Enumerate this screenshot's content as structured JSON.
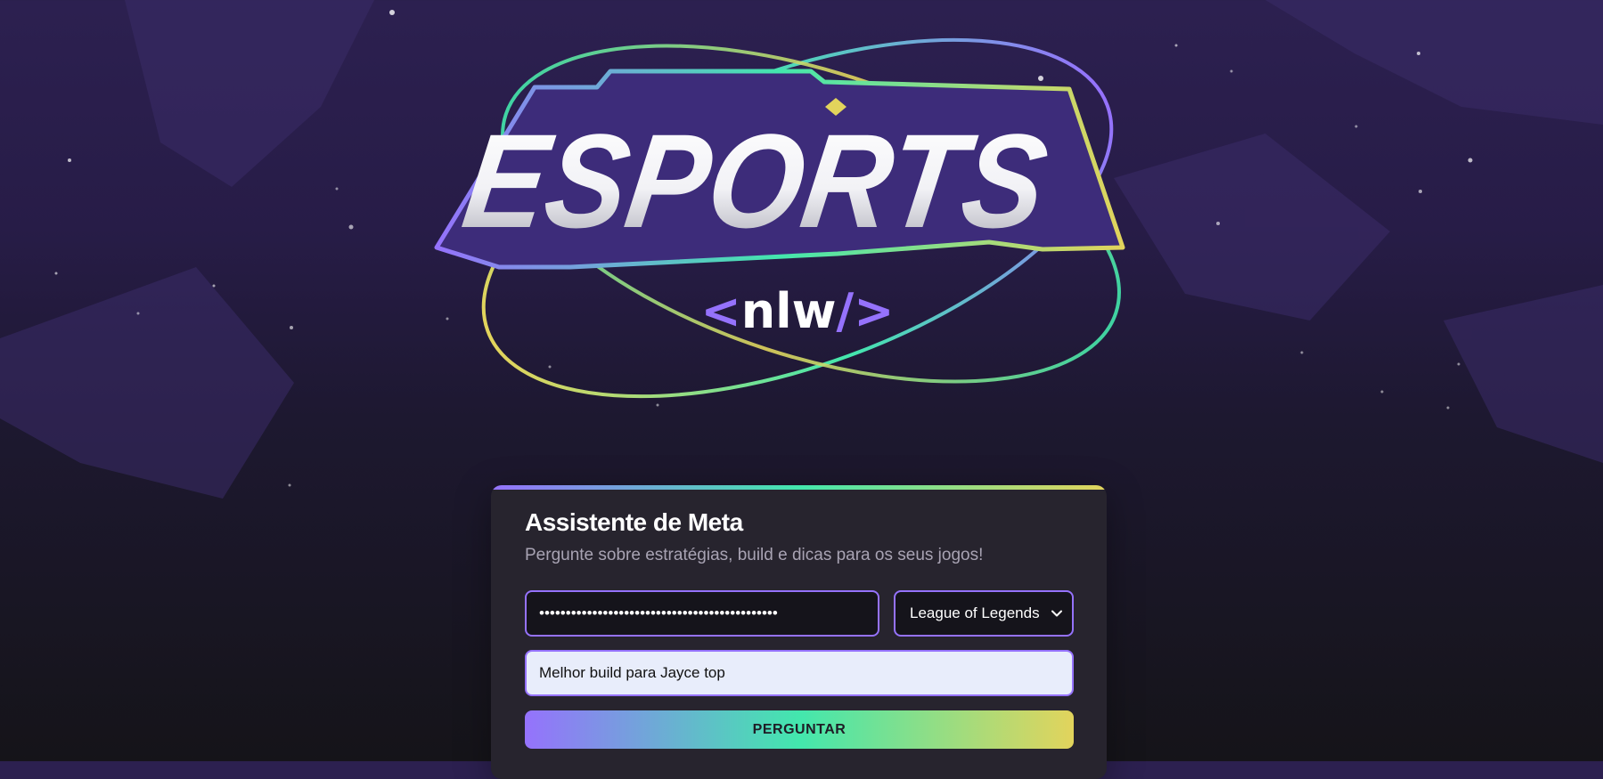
{
  "logo": {
    "wordmark": "ESPORTS",
    "tagline": "<nlw/>",
    "tagline_open": "<",
    "tagline_text": "nlw",
    "tagline_slash": "/",
    "tagline_close": ">"
  },
  "colors": {
    "purple": "#9572fc",
    "green": "#43e7ad",
    "yellow": "#e2d45c",
    "card_bg": "#27242e",
    "input_bg": "#15141b",
    "question_bg": "#e8edfb"
  },
  "assistant": {
    "title": "Assistente de Meta",
    "subtitle": "Pergunte sobre estratégias, build e dicas para os seus jogos!",
    "api_key_value": "•••••••••••••••••••••••••••••••••••••••••••••",
    "game_select": {
      "selected": "League of Legends",
      "icon": "chevron-down-icon"
    },
    "question_value": "Melhor build para Jayce top",
    "ask_button": "PERGUNTAR"
  }
}
